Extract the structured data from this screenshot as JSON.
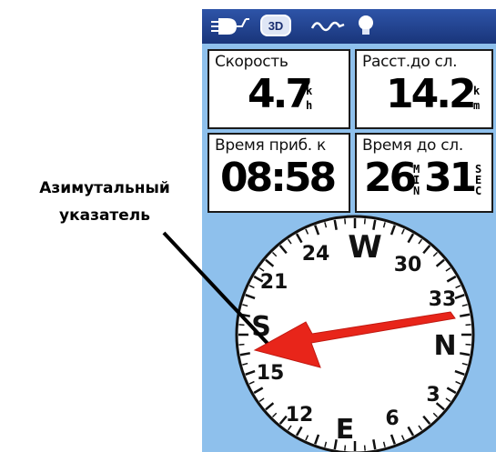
{
  "status_icons": [
    "satellite-receiver-icon",
    "3d-fix-icon",
    "track-wave-icon",
    "backlight-bulb-icon"
  ],
  "status_bar": {
    "fix_mode": "3D"
  },
  "fields": {
    "speed": {
      "label": "Скорость",
      "value": "4.7",
      "unit_top": "k",
      "unit_bottom": "h"
    },
    "dist_next": {
      "label": "Расст.до сл.",
      "value": "14.2",
      "unit_top": "k",
      "unit_bottom": "m"
    },
    "eta": {
      "label": "Время приб. к",
      "value": "08:58"
    },
    "time_next": {
      "label": "Время до сл.",
      "value_main": "26",
      "unit_min": [
        "M",
        "I",
        "N"
      ],
      "value_sec": "31",
      "unit_sec": [
        "S",
        "E",
        "C"
      ]
    }
  },
  "callout": {
    "line1": "Азимутальный",
    "line2": "указатель"
  },
  "compass": {
    "cardinals": {
      "north": "N",
      "east": "E",
      "south": "S",
      "west": "W"
    },
    "ticks": {
      "t3": "3",
      "t6": "6",
      "t12": "12",
      "t15": "15",
      "t21": "21",
      "t24": "24",
      "t30": "30",
      "t33": "33"
    },
    "bearing_pointer_color": "#e8251a"
  },
  "colors": {
    "screen_bg": "#8ec0ec",
    "status_bar": "#23449a",
    "pointer": "#e8251a"
  }
}
